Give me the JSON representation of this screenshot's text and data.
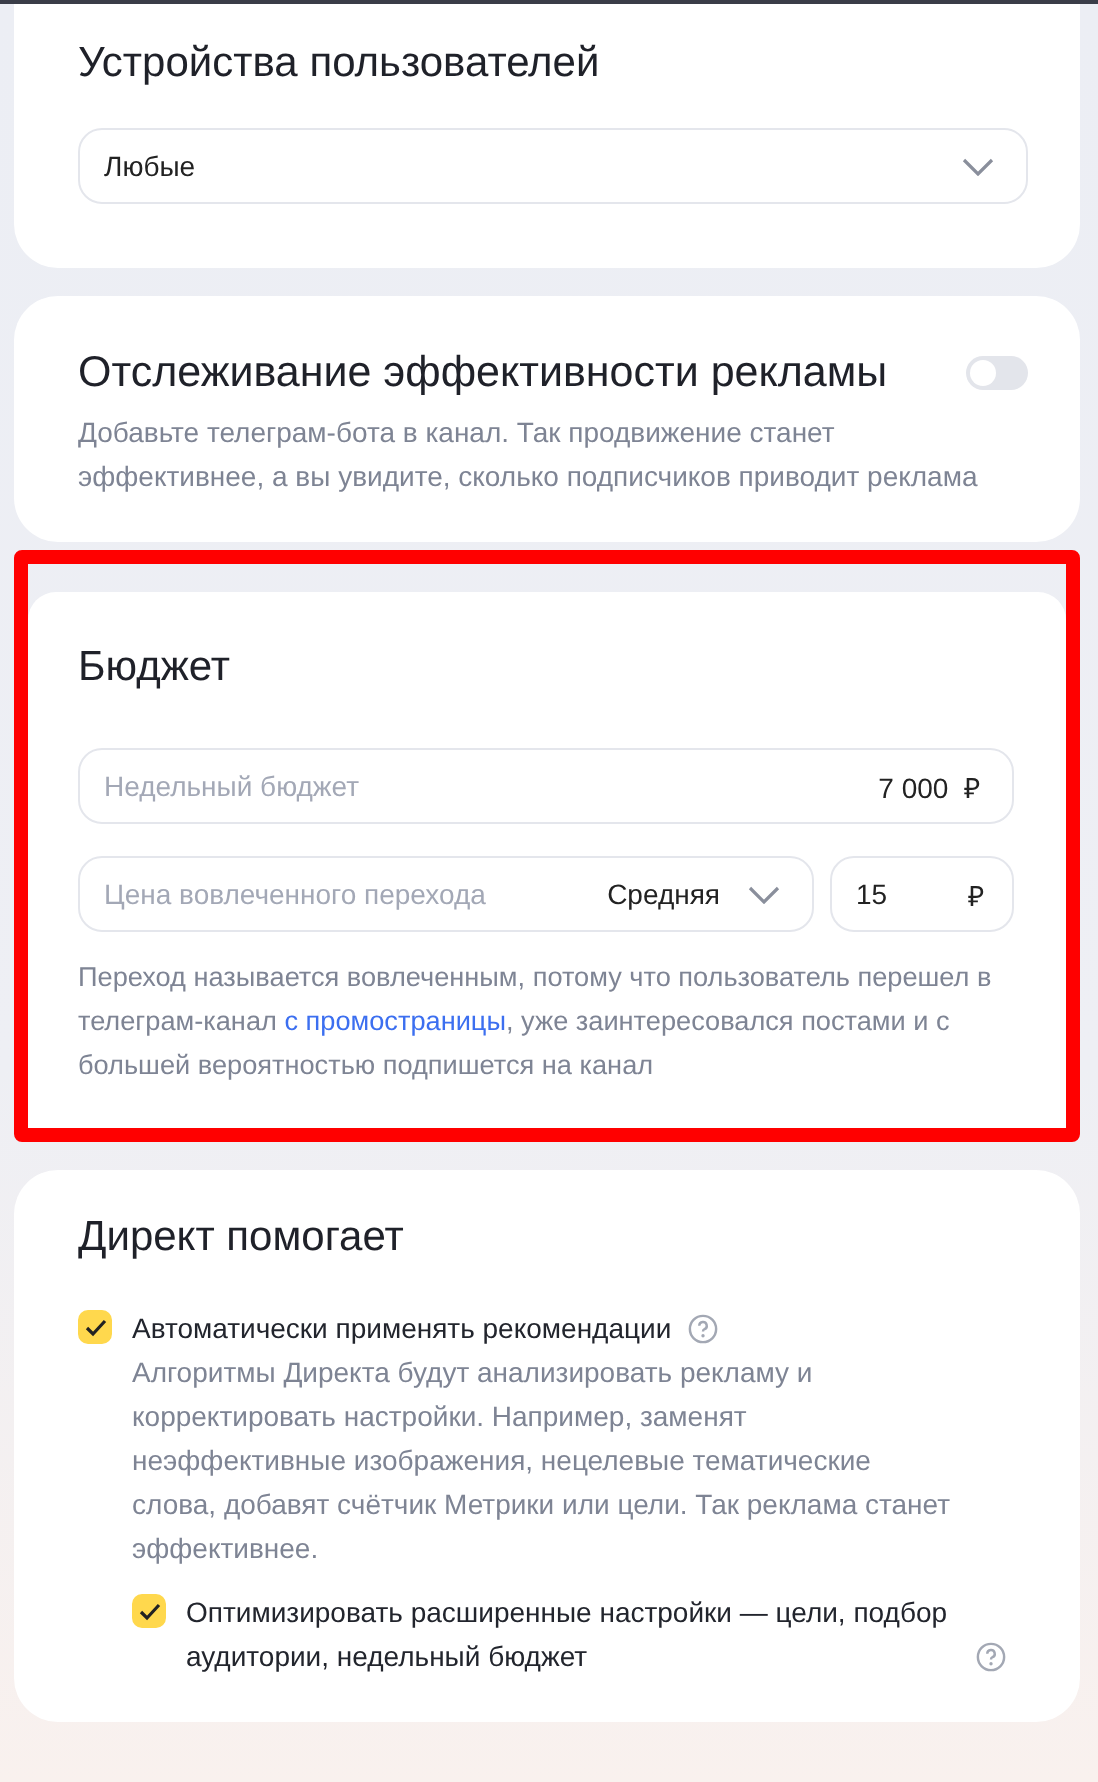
{
  "devices": {
    "title": "Устройства пользователей",
    "select": {
      "value": "Любые"
    }
  },
  "tracking": {
    "title": "Отслеживание эффективности рекламы",
    "toggle": {
      "on": false
    },
    "description": "Добавьте телеграм-бота в канал. Так продвижение станет эффективнее, а вы увидите, сколько подписчиков приводит реклама"
  },
  "budget": {
    "highlighted": true,
    "title": "Бюджет",
    "weekly": {
      "label": "Недельный бюджет",
      "value": "7 000",
      "currency": "₽"
    },
    "price": {
      "label": "Цена вовлеченного перехода",
      "mode": "Средняя",
      "value": "15",
      "currency": "₽"
    },
    "note": {
      "before": "Переход называется вовлеченным, потому что пользователь перешел в телеграм-канал ",
      "link": "с промостраницы",
      "after": ", уже заинтересовался постами и с большей вероятностью подпишется на канал"
    }
  },
  "direct": {
    "title": "Директ помогает",
    "options": [
      {
        "label": "Автоматически применять рекомендации",
        "checked": true,
        "help": true,
        "description": "Алгоритмы Директа будут анализировать рекламу и корректировать настройки. Например, заменят неэффективные изображения, нецелевые тематические слова, добавят счётчик Метрики или цели. Так реклама станет эффективнее.",
        "children": [
          {
            "label": "Оптимизировать расширенные настройки — цели, подбор аудитории, недельный бюджет",
            "checked": true,
            "help": true
          }
        ]
      }
    ]
  }
}
